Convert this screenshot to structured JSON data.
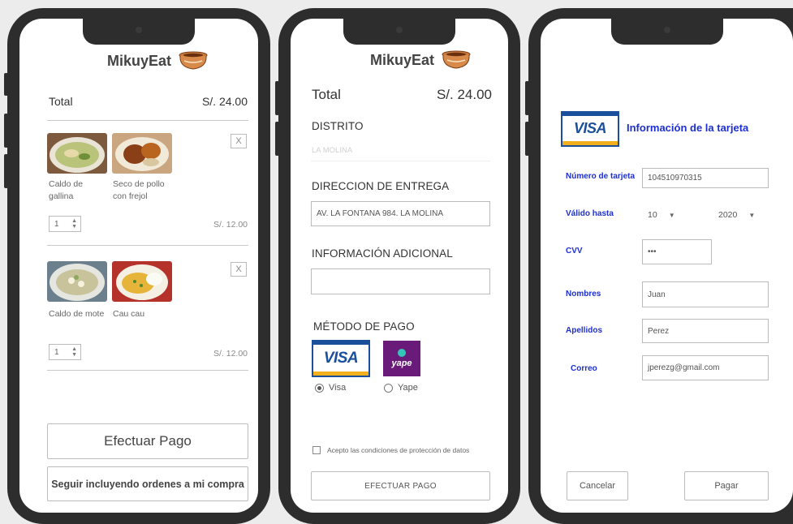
{
  "colors": {
    "phone_frame": "#2d2d2d",
    "link_blue": "#1d2fd0",
    "visa_blue": "#1a4f9c",
    "visa_gold": "#f2b11c",
    "yape_purple": "#6a1b7a"
  },
  "screen1": {
    "brand": "MikuyEat",
    "total_label": "Total",
    "total_value": "S/. 24.00",
    "items": [
      {
        "dishes": [
          {
            "name": "Caldo de gallina",
            "image": "soup-photo"
          },
          {
            "name": "Seco de pollo con frejol",
            "image": "stew-photo"
          }
        ],
        "remove_label": "X",
        "qty": "1",
        "price": "S/. 12.00"
      },
      {
        "dishes": [
          {
            "name": "Caldo de mote",
            "image": "mote-photo"
          },
          {
            "name": "Cau cau",
            "image": "caucau-photo"
          }
        ],
        "remove_label": "X",
        "qty": "1",
        "price": "S/. 12.00"
      }
    ],
    "pay_button": "Efectuar Pago",
    "continue_button": "Seguir incluyendo ordenes a mi compra"
  },
  "screen2": {
    "brand": "MikuyEat",
    "total_label": "Total",
    "total_value": "S/. 24.00",
    "district_label": "DISTRITO",
    "district_value": "LA MOLINA",
    "address_label": "DIRECCION DE ENTREGA",
    "address_value": "AV. LA FONTANA 984. LA MOLINA",
    "additional_label": "INFORMACIÓN ADICIONAL",
    "additional_value": "",
    "payment_label": "MÉTODO DE PAGO",
    "visa_text": "VISA",
    "yape_text": "yape",
    "option_visa": "Visa",
    "option_yape": "Yape",
    "selected_option": "Visa",
    "terms_label": "Acepto las condiciones de protección de datos",
    "submit_button": "EFECTUAR PAGO"
  },
  "screen3": {
    "visa_text": "VISA",
    "title": "Información de la tarjeta",
    "card_number_label": "Número de tarjeta",
    "card_number_value": "104510970315",
    "valid_label": "Válido hasta",
    "month_value": "10",
    "year_value": "2020",
    "cvv_label": "CVV",
    "cvv_value": "•••",
    "names_label": "Nombres",
    "names_value": "Juan",
    "surnames_label": "Apellidos",
    "surnames_value": "Perez",
    "email_label": "Correo",
    "email_value": "jperezg@gmail.com",
    "cancel_button": "Cancelar",
    "pay_button": "Pagar"
  }
}
